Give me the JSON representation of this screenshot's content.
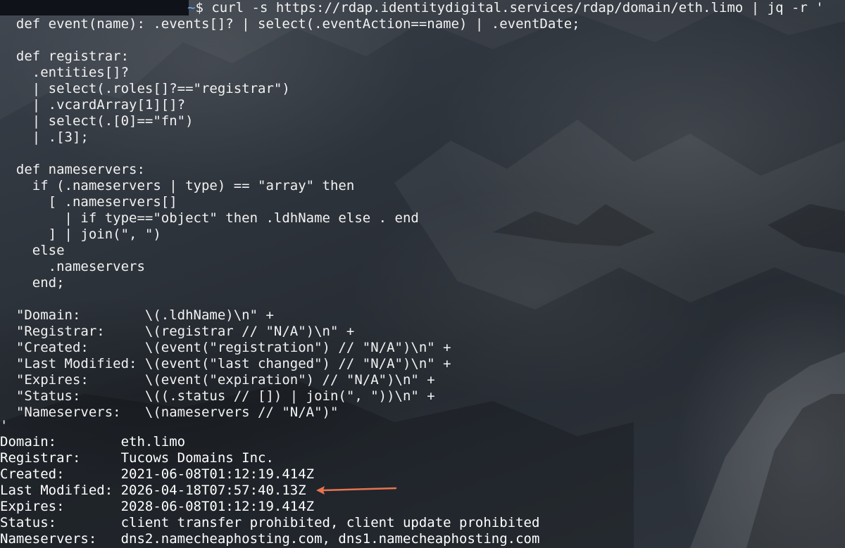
{
  "terminal": {
    "command": {
      "prompt_path": "~",
      "prompt_symbol": "$",
      "text": " curl -s https://rdap.identitydigital.services/rdap/domain/eth.limo | jq -r '"
    },
    "script_lines": [
      "  def event(name): .events[]? | select(.eventAction==name) | .eventDate;",
      "",
      "  def registrar:",
      "    .entities[]?",
      "    | select(.roles[]?==\"registrar\")",
      "    | .vcardArray[1][]?",
      "    | select(.[0]==\"fn\")",
      "    | .[3];",
      "",
      "  def nameservers:",
      "    if (.nameservers | type) == \"array\" then",
      "      [ .nameservers[]",
      "        | if type==\"object\" then .ldhName else . end",
      "      ] | join(\", \")",
      "    else",
      "      .nameservers",
      "    end;",
      "",
      "  \"Domain:        \\(.ldhName)\\n\" +",
      "  \"Registrar:     \\(registrar // \"N/A\")\\n\" +",
      "  \"Created:       \\(event(\"registration\") // \"N/A\")\\n\" +",
      "  \"Last Modified: \\(event(\"last changed\") // \"N/A\")\\n\" +",
      "  \"Expires:       \\(event(\"expiration\") // \"N/A\")\\n\" +",
      "  \"Status:        \\((.status // []) | join(\", \"))\\n\" +",
      "  \"Nameservers:   \\(nameservers // \"N/A\")\"",
      "'"
    ],
    "output_lines": [
      "Domain:        eth.limo",
      "Registrar:     Tucows Domains Inc.",
      "Created:       2021-06-08T01:12:19.414Z",
      "Last Modified: 2026-04-18T07:57:40.13Z",
      "Expires:       2028-06-08T01:12:19.414Z",
      "Status:        client transfer prohibited, client update prohibited",
      "Nameservers:   dns2.namecheaphosting.com, dns1.namecheaphosting.com"
    ],
    "annotation": {
      "type": "arrow",
      "points_to": "Last Modified",
      "color": "#e8734f"
    },
    "colors": {
      "text": "#f2f2f2",
      "prompt_path": "#67b1ff",
      "prompt_bar": "#0f1319"
    }
  }
}
